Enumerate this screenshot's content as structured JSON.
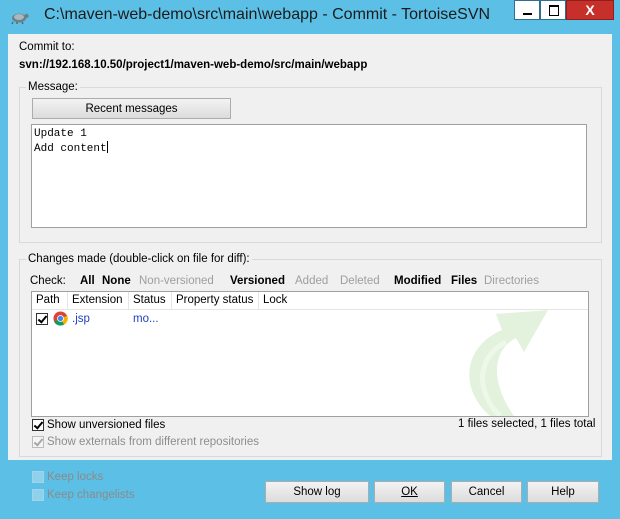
{
  "window": {
    "title": "C:\\maven-web-demo\\src\\main\\webapp - Commit - TortoiseSVN",
    "close_glyph": "X"
  },
  "commit": {
    "to_label": "Commit to:",
    "url": "svn://192.168.10.50/project1/maven-web-demo/src/main/webapp"
  },
  "message": {
    "group_label": "Message:",
    "recent_button": "Recent messages",
    "text": "Update 1\nAdd content"
  },
  "changes": {
    "group_label": "Changes made (double-click on file for diff):",
    "check_label": "Check:",
    "filters": [
      {
        "label": "All",
        "enabled": true
      },
      {
        "label": "None",
        "enabled": true
      },
      {
        "label": "Non-versioned",
        "enabled": false
      },
      {
        "label": "Versioned",
        "enabled": true
      },
      {
        "label": "Added",
        "enabled": false
      },
      {
        "label": "Deleted",
        "enabled": false
      },
      {
        "label": "Modified",
        "enabled": true
      },
      {
        "label": "Files",
        "enabled": true
      },
      {
        "label": "Directories",
        "enabled": false
      }
    ],
    "columns": [
      "Path",
      "Extension",
      "Status",
      "Property status",
      "Lock"
    ],
    "rows": [
      {
        "checked": true,
        "path": "",
        "extension": ".jsp",
        "status": "mo...",
        "property_status": "",
        "lock": ""
      }
    ],
    "show_unversioned_label": "Show unversioned files",
    "show_externals_label": "Show externals from different repositories",
    "selection_summary": "1 files selected, 1 files total"
  },
  "bottom": {
    "keep_locks": "Keep locks",
    "keep_changelists": "Keep changelists",
    "buttons": {
      "show_log": "Show log",
      "ok": "OK",
      "cancel": "Cancel",
      "help": "Help"
    }
  },
  "colors": {
    "frame": "#5cc0e6",
    "client": "#f0f0f0",
    "link_text": "#1f3fbf",
    "close": "#c7302a"
  }
}
